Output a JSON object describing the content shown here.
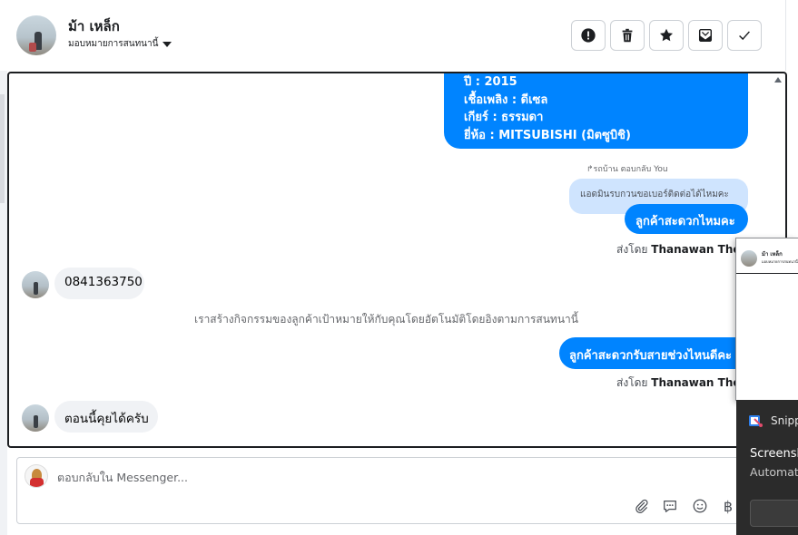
{
  "header": {
    "contact_name": "ม้า เหล็ก",
    "assign_label": "มอบหมายการสนทนานี้",
    "actions": [
      {
        "name": "report-button",
        "icon": "exclamation-circle-icon"
      },
      {
        "name": "delete-button",
        "icon": "trash-icon"
      },
      {
        "name": "star-button",
        "icon": "star-icon"
      },
      {
        "name": "mark-unread-button",
        "icon": "envelope-icon"
      },
      {
        "name": "done-button",
        "icon": "checkmark-icon"
      }
    ]
  },
  "messages": {
    "vehicle_info": [
      "ปี : 2015",
      "เชื้อเพลิง : ดีเซล",
      "เกียร์ : ธรรมดา",
      "ยี่ห้อ : MITSUBISHI (มิตซูบิชิ)"
    ],
    "reply_reference": "↱รถบ้าน ตอบกลับ You",
    "quoted_text": "แอดมินรบกวนขอเบอร์ติดต่อได้ไหมคะ",
    "agent_msg_1": "ลูกค้าสะดวกไหมคะ",
    "sent_by_prefix": "ส่งโดย",
    "agent_name": "Thanawan Thon",
    "customer_phone": "0841363750",
    "system_note": "เราสร้างกิจกรรมของลูกค้าเป้าหมายให้กับคุณโดยอัตโนมัติโดยอิงตามการสนทนานี้",
    "agent_msg_2": "ลูกค้าสะดวกรับสายช่วงไหนดีคะ",
    "customer_msg_2": "ตอนนี้คุยได้ครับ"
  },
  "composer": {
    "placeholder": "ตอบกลับใน Messenger...",
    "currency_symbol": "฿"
  },
  "snip_thumbnail": {
    "name": "ม้า เหล็ก",
    "sub": "มอบหมายการสนทนานี้"
  },
  "toast": {
    "app_name": "Snipp",
    "title": "Screensh",
    "subtitle": "Automat"
  },
  "colors": {
    "accent": "#0084ff",
    "bubble_gray": "#f0f2f5",
    "quoted_bg": "#cfe4fe",
    "toast_bg": "#2b2b2b"
  }
}
